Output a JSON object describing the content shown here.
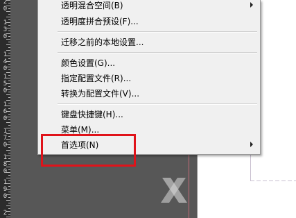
{
  "ruler": {
    "labels": [
      {
        "text": "2\n0"
      },
      {
        "text": "1\n3\n0"
      },
      {
        "text": "1\n4\n0"
      },
      {
        "text": "1\n5\n0"
      },
      {
        "text": "1\n6\n0"
      },
      {
        "text": "1\n7\n0"
      },
      {
        "text": "1\n8\n0"
      },
      {
        "text": "1\n9\n0"
      },
      {
        "text": "2"
      }
    ]
  },
  "menu": {
    "items": [
      {
        "label": "透明混合空间(B)",
        "submenu": true
      },
      {
        "label": "透明度拼合预设(F)...",
        "submenu": false
      },
      {
        "label": "迁移之前的本地设置...",
        "submenu": false
      },
      {
        "label": "颜色设置(G)...",
        "submenu": false
      },
      {
        "label": "指定配置文件(R)...",
        "submenu": false
      },
      {
        "label": "转换为配置文件(V)...",
        "submenu": false
      },
      {
        "label": "键盘快捷键(H)...",
        "submenu": false
      },
      {
        "label": "菜单(M)...",
        "submenu": false
      },
      {
        "label": "首选项(N)",
        "submenu": true
      }
    ]
  },
  "annotation": {
    "color": "#e0131a"
  },
  "canvas": {
    "background": "#575757"
  }
}
